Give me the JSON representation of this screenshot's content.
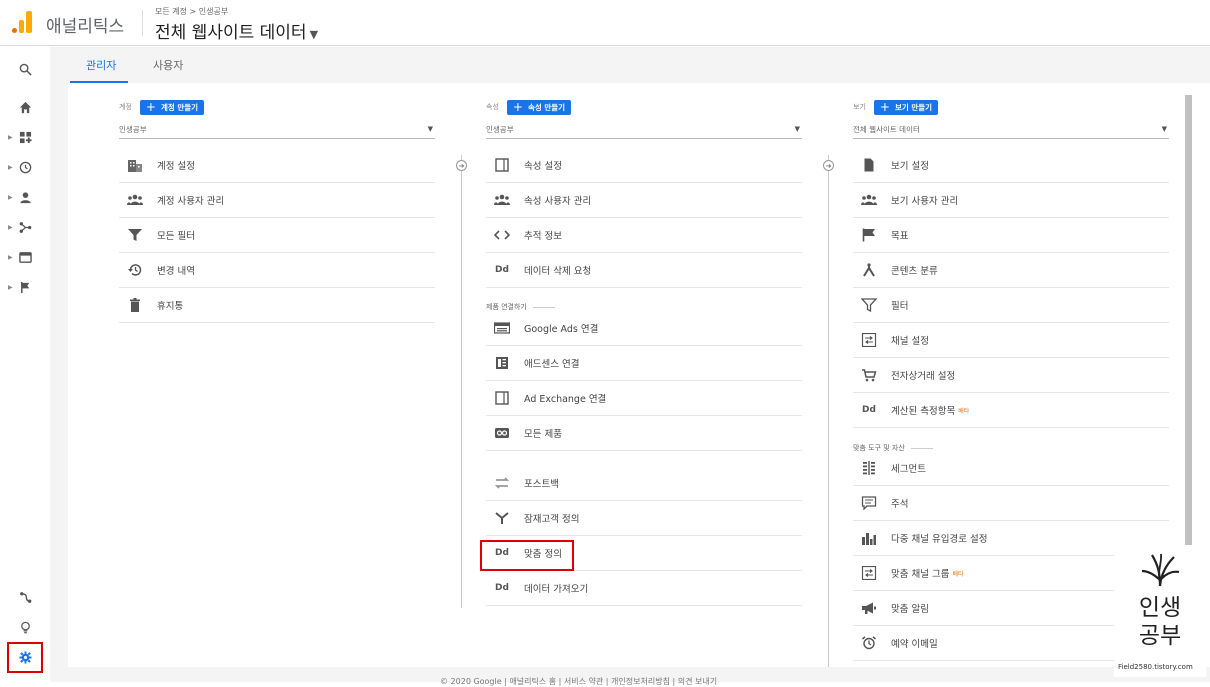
{
  "header": {
    "brand": "애널리틱스",
    "breadcrumb": "모든 계정 > 인생공부",
    "view_name": "전체 웹사이트 데이터"
  },
  "tabs": [
    {
      "label": "관리자",
      "active": true
    },
    {
      "label": "사용자",
      "active": false
    }
  ],
  "account_col": {
    "label": "계정",
    "create_label": "계정 만들기",
    "selected": "인생공부",
    "items": [
      {
        "label": "계정 설정",
        "icon": "building-icon"
      },
      {
        "label": "계정 사용자 관리",
        "icon": "people-icon"
      },
      {
        "label": "모든 필터",
        "icon": "filter-icon"
      },
      {
        "label": "변경 내역",
        "icon": "history-icon"
      },
      {
        "label": "휴지통",
        "icon": "trash-icon"
      }
    ]
  },
  "property_col": {
    "label": "속성",
    "create_label": "속성 만들기",
    "selected": "인생공부",
    "items": [
      {
        "label": "속성 설정",
        "icon": "window-icon"
      },
      {
        "label": "속성 사용자 관리",
        "icon": "people-icon"
      },
      {
        "label": "추적 정보",
        "icon": "code-icon"
      },
      {
        "label": "데이터 삭제 요청",
        "icon": "dd-icon"
      }
    ],
    "section_title": "제품 연결하기",
    "link_items": [
      {
        "label": "Google Ads 연결",
        "icon": "ads-icon"
      },
      {
        "label": "애드센스 연결",
        "icon": "adsense-icon"
      },
      {
        "label": "Ad Exchange 연결",
        "icon": "window-icon"
      },
      {
        "label": "모든 제품",
        "icon": "link-icon"
      }
    ],
    "more_items": [
      {
        "label": "포스트백",
        "icon": "postback-icon"
      },
      {
        "label": "잠재고객 정의",
        "icon": "audience-icon"
      },
      {
        "label": "맞춤 정의",
        "icon": "dd-icon"
      },
      {
        "label": "데이터 가져오기",
        "icon": "dd-icon"
      }
    ]
  },
  "view_col": {
    "label": "보기",
    "create_label": "보기 만들기",
    "selected": "전체 웹사이트 데이터",
    "items": [
      {
        "label": "보기 설정",
        "icon": "document-icon"
      },
      {
        "label": "보기 사용자 관리",
        "icon": "people-icon"
      },
      {
        "label": "목표",
        "icon": "flag-icon"
      },
      {
        "label": "콘텐츠 분류",
        "icon": "grouping-icon"
      },
      {
        "label": "필터",
        "icon": "filter-icon"
      },
      {
        "label": "채널 설정",
        "icon": "channel-icon"
      },
      {
        "label": "전자상거래 설정",
        "icon": "cart-icon"
      },
      {
        "label": "계산된 측정항목",
        "icon": "dd-icon",
        "beta": "베타"
      }
    ],
    "section_title": "맞춤 도구 및 자산",
    "tool_items": [
      {
        "label": "세그먼트",
        "icon": "segment-icon"
      },
      {
        "label": "주석",
        "icon": "annotation-icon"
      },
      {
        "label": "다중 채널 유입경로 설정",
        "icon": "bar-chart-icon"
      },
      {
        "label": "맞춤 채널 그룹",
        "icon": "channel-icon",
        "beta": "베타"
      },
      {
        "label": "맞춤 알림",
        "icon": "megaphone-icon"
      },
      {
        "label": "예약 이메일",
        "icon": "alarm-icon"
      }
    ]
  },
  "footer": "© 2020 Google | 애널리틱스 홈 | 서비스 약관 | 개인정보처리방침 | 의견 보내기",
  "watermark": {
    "line1": "인생",
    "line2": "공부",
    "url": "Field2580.tistory.com"
  },
  "colors": {
    "accent": "#1a73e8",
    "highlight": "#dd0000",
    "logo_orange": "#f9ab00",
    "logo_dark": "#e37400"
  }
}
